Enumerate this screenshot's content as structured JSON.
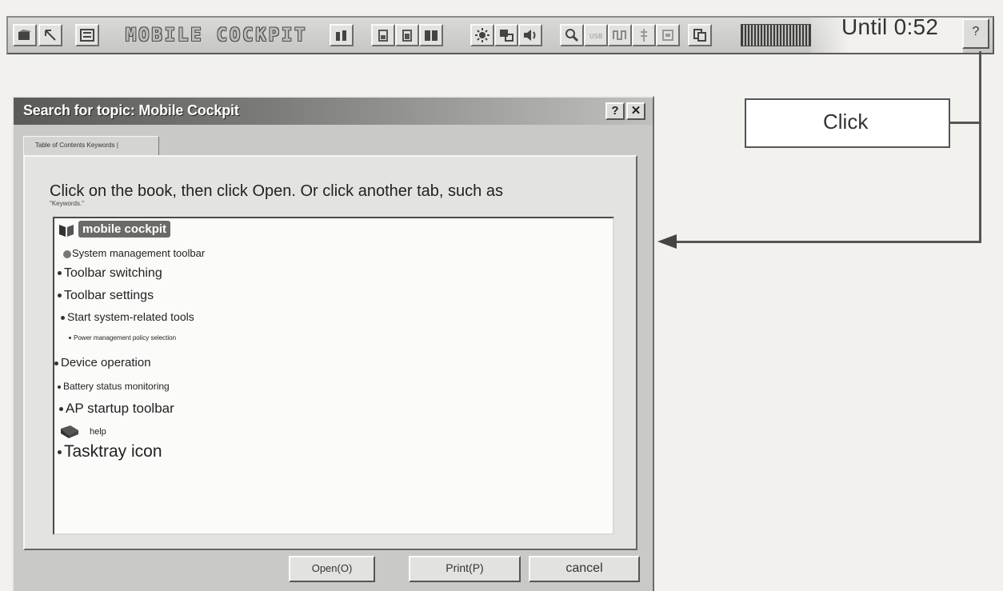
{
  "toolbar": {
    "title": "MOBILE COCKPIT",
    "until_label": "Until 0:52",
    "help_label": "?",
    "icons": [
      "mobile-cockpit-icon",
      "pointer-icon",
      "settings-icon",
      "battery-icon",
      "battery-a-icon",
      "battery-b-icon",
      "battery-c-icon",
      "brightness-icon",
      "display-icon",
      "speaker-icon",
      "search-icon",
      "usb-icon",
      "wave-icon",
      "tower-icon",
      "card-icon",
      "copy-icon"
    ]
  },
  "callout": {
    "text": "Click"
  },
  "dialog": {
    "title": "Search for topic: Mobile Cockpit",
    "help_button": "?",
    "close_button": "✕",
    "tab_label": "Table of Contents Keywords |",
    "instruction": "Click on the book, then click Open. Or click another tab, such as",
    "keywords_note": "\"Keywords.\"",
    "tree": {
      "root": "mobile cockpit",
      "items": [
        "System management toolbar",
        "Toolbar switching",
        "Toolbar settings",
        "Start system-related tools",
        "Power management policy selection",
        "Device operation",
        "Battery status monitoring",
        "AP startup toolbar",
        "help",
        "Tasktray icon"
      ]
    },
    "buttons": {
      "open": "Open(O)",
      "print": "Print(P)",
      "cancel": "cancel"
    }
  },
  "colors": {
    "titlebar_dark": "#5a5a58",
    "dialog_face": "#c9c9c5",
    "listbox_bg": "#fbfbfa"
  }
}
